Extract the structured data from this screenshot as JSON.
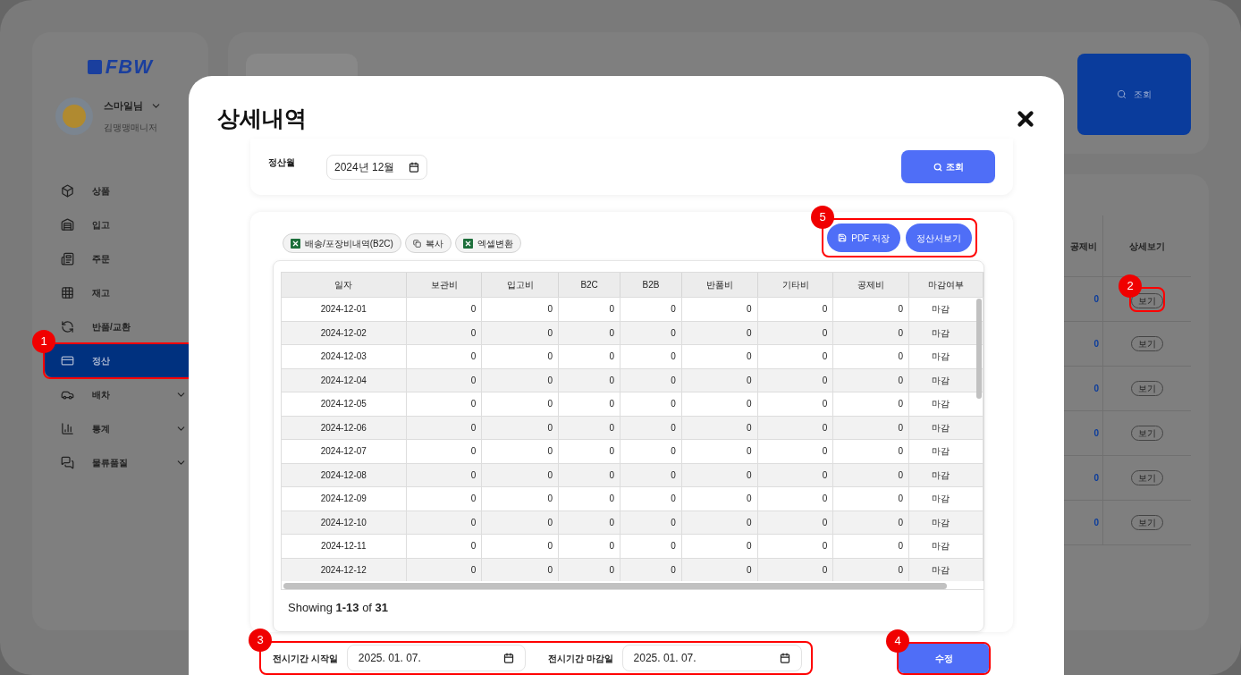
{
  "sidebar": {
    "logo": "FBW",
    "user": {
      "name": "스마일님",
      "role": "김맹맹매니저"
    },
    "items": [
      {
        "label": "상품",
        "selected": false,
        "expandable": false
      },
      {
        "label": "입고",
        "selected": false,
        "expandable": false
      },
      {
        "label": "주문",
        "selected": false,
        "expandable": false
      },
      {
        "label": "재고",
        "selected": false,
        "expandable": false
      },
      {
        "label": "반품/교환",
        "selected": false,
        "expandable": false
      },
      {
        "label": "정산",
        "selected": true,
        "expandable": false,
        "marker": "1"
      },
      {
        "label": "배차",
        "selected": false,
        "expandable": true
      },
      {
        "label": "통계",
        "selected": false,
        "expandable": true
      },
      {
        "label": "물류품질",
        "selected": false,
        "expandable": true
      }
    ]
  },
  "background": {
    "search_button": "조회",
    "table": {
      "columns": [
        "공제비",
        "상세보기"
      ],
      "rows": [
        {
          "deduction": "0",
          "action": "보기",
          "marker": "2"
        },
        {
          "deduction": "0",
          "action": "보기"
        },
        {
          "deduction": "0",
          "action": "보기"
        },
        {
          "deduction": "0",
          "action": "보기"
        },
        {
          "deduction": "0",
          "action": "보기"
        },
        {
          "deduction": "0",
          "action": "보기"
        }
      ]
    }
  },
  "modal": {
    "title": "상세내역",
    "filter": {
      "label": "정산월",
      "month": "2024년 12월",
      "search_button": "조회"
    },
    "toolbar": {
      "buttons": [
        {
          "label": "배송/포장비내역(B2C)",
          "kind": "excel"
        },
        {
          "label": "복사",
          "kind": "copy"
        },
        {
          "label": "엑셀변환",
          "kind": "excel"
        }
      ],
      "actions": {
        "marker": "5",
        "buttons": [
          {
            "label": "PDF 저장",
            "kind": "save"
          },
          {
            "label": "정산서보기",
            "kind": "plain"
          }
        ]
      }
    },
    "table": {
      "columns": [
        "일자",
        "보관비",
        "입고비",
        "B2C",
        "B2B",
        "반품비",
        "기타비",
        "공제비",
        "마감여부"
      ],
      "rows": [
        [
          "2024-12-01",
          "0",
          "0",
          "0",
          "0",
          "0",
          "0",
          "0",
          "마감"
        ],
        [
          "2024-12-02",
          "0",
          "0",
          "0",
          "0",
          "0",
          "0",
          "0",
          "마감"
        ],
        [
          "2024-12-03",
          "0",
          "0",
          "0",
          "0",
          "0",
          "0",
          "0",
          "마감"
        ],
        [
          "2024-12-04",
          "0",
          "0",
          "0",
          "0",
          "0",
          "0",
          "0",
          "마감"
        ],
        [
          "2024-12-05",
          "0",
          "0",
          "0",
          "0",
          "0",
          "0",
          "0",
          "마감"
        ],
        [
          "2024-12-06",
          "0",
          "0",
          "0",
          "0",
          "0",
          "0",
          "0",
          "마감"
        ],
        [
          "2024-12-07",
          "0",
          "0",
          "0",
          "0",
          "0",
          "0",
          "0",
          "마감"
        ],
        [
          "2024-12-08",
          "0",
          "0",
          "0",
          "0",
          "0",
          "0",
          "0",
          "마감"
        ],
        [
          "2024-12-09",
          "0",
          "0",
          "0",
          "0",
          "0",
          "0",
          "0",
          "마감"
        ],
        [
          "2024-12-10",
          "0",
          "0",
          "0",
          "0",
          "0",
          "0",
          "0",
          "마감"
        ],
        [
          "2024-12-11",
          "0",
          "0",
          "0",
          "0",
          "0",
          "0",
          "0",
          "마감"
        ],
        [
          "2024-12-12",
          "0",
          "0",
          "0",
          "0",
          "0",
          "0",
          "0",
          "마감"
        ]
      ]
    },
    "footer": "Showing **1-13** of **31**",
    "period": {
      "marker": "3",
      "start_label": "전시기간 시작일",
      "start": "2025. 01. 07.",
      "end_label": "전시기간 마감일",
      "end": "2025. 01. 07."
    },
    "edit_button": {
      "label": "수정",
      "marker": "4"
    }
  }
}
